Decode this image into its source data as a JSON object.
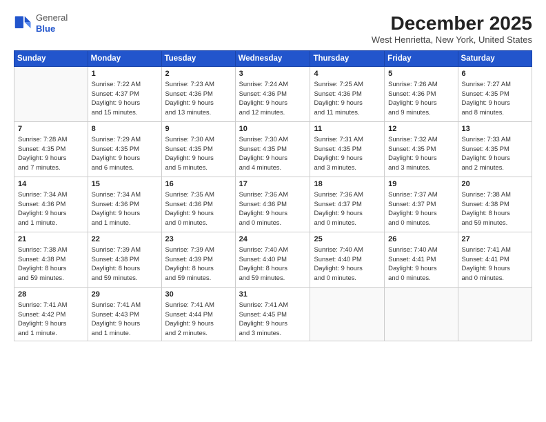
{
  "logo": {
    "general": "General",
    "blue": "Blue"
  },
  "title": "December 2025",
  "location": "West Henrietta, New York, United States",
  "days_header": [
    "Sunday",
    "Monday",
    "Tuesday",
    "Wednesday",
    "Thursday",
    "Friday",
    "Saturday"
  ],
  "weeks": [
    [
      {
        "day": "",
        "info": ""
      },
      {
        "day": "1",
        "info": "Sunrise: 7:22 AM\nSunset: 4:37 PM\nDaylight: 9 hours\nand 15 minutes."
      },
      {
        "day": "2",
        "info": "Sunrise: 7:23 AM\nSunset: 4:36 PM\nDaylight: 9 hours\nand 13 minutes."
      },
      {
        "day": "3",
        "info": "Sunrise: 7:24 AM\nSunset: 4:36 PM\nDaylight: 9 hours\nand 12 minutes."
      },
      {
        "day": "4",
        "info": "Sunrise: 7:25 AM\nSunset: 4:36 PM\nDaylight: 9 hours\nand 11 minutes."
      },
      {
        "day": "5",
        "info": "Sunrise: 7:26 AM\nSunset: 4:36 PM\nDaylight: 9 hours\nand 9 minutes."
      },
      {
        "day": "6",
        "info": "Sunrise: 7:27 AM\nSunset: 4:35 PM\nDaylight: 9 hours\nand 8 minutes."
      }
    ],
    [
      {
        "day": "7",
        "info": "Sunrise: 7:28 AM\nSunset: 4:35 PM\nDaylight: 9 hours\nand 7 minutes."
      },
      {
        "day": "8",
        "info": "Sunrise: 7:29 AM\nSunset: 4:35 PM\nDaylight: 9 hours\nand 6 minutes."
      },
      {
        "day": "9",
        "info": "Sunrise: 7:30 AM\nSunset: 4:35 PM\nDaylight: 9 hours\nand 5 minutes."
      },
      {
        "day": "10",
        "info": "Sunrise: 7:30 AM\nSunset: 4:35 PM\nDaylight: 9 hours\nand 4 minutes."
      },
      {
        "day": "11",
        "info": "Sunrise: 7:31 AM\nSunset: 4:35 PM\nDaylight: 9 hours\nand 3 minutes."
      },
      {
        "day": "12",
        "info": "Sunrise: 7:32 AM\nSunset: 4:35 PM\nDaylight: 9 hours\nand 3 minutes."
      },
      {
        "day": "13",
        "info": "Sunrise: 7:33 AM\nSunset: 4:35 PM\nDaylight: 9 hours\nand 2 minutes."
      }
    ],
    [
      {
        "day": "14",
        "info": "Sunrise: 7:34 AM\nSunset: 4:36 PM\nDaylight: 9 hours\nand 1 minute."
      },
      {
        "day": "15",
        "info": "Sunrise: 7:34 AM\nSunset: 4:36 PM\nDaylight: 9 hours\nand 1 minute."
      },
      {
        "day": "16",
        "info": "Sunrise: 7:35 AM\nSunset: 4:36 PM\nDaylight: 9 hours\nand 0 minutes."
      },
      {
        "day": "17",
        "info": "Sunrise: 7:36 AM\nSunset: 4:36 PM\nDaylight: 9 hours\nand 0 minutes."
      },
      {
        "day": "18",
        "info": "Sunrise: 7:36 AM\nSunset: 4:37 PM\nDaylight: 9 hours\nand 0 minutes."
      },
      {
        "day": "19",
        "info": "Sunrise: 7:37 AM\nSunset: 4:37 PM\nDaylight: 9 hours\nand 0 minutes."
      },
      {
        "day": "20",
        "info": "Sunrise: 7:38 AM\nSunset: 4:38 PM\nDaylight: 8 hours\nand 59 minutes."
      }
    ],
    [
      {
        "day": "21",
        "info": "Sunrise: 7:38 AM\nSunset: 4:38 PM\nDaylight: 8 hours\nand 59 minutes."
      },
      {
        "day": "22",
        "info": "Sunrise: 7:39 AM\nSunset: 4:38 PM\nDaylight: 8 hours\nand 59 minutes."
      },
      {
        "day": "23",
        "info": "Sunrise: 7:39 AM\nSunset: 4:39 PM\nDaylight: 8 hours\nand 59 minutes."
      },
      {
        "day": "24",
        "info": "Sunrise: 7:40 AM\nSunset: 4:40 PM\nDaylight: 8 hours\nand 59 minutes."
      },
      {
        "day": "25",
        "info": "Sunrise: 7:40 AM\nSunset: 4:40 PM\nDaylight: 9 hours\nand 0 minutes."
      },
      {
        "day": "26",
        "info": "Sunrise: 7:40 AM\nSunset: 4:41 PM\nDaylight: 9 hours\nand 0 minutes."
      },
      {
        "day": "27",
        "info": "Sunrise: 7:41 AM\nSunset: 4:41 PM\nDaylight: 9 hours\nand 0 minutes."
      }
    ],
    [
      {
        "day": "28",
        "info": "Sunrise: 7:41 AM\nSunset: 4:42 PM\nDaylight: 9 hours\nand 1 minute."
      },
      {
        "day": "29",
        "info": "Sunrise: 7:41 AM\nSunset: 4:43 PM\nDaylight: 9 hours\nand 1 minute."
      },
      {
        "day": "30",
        "info": "Sunrise: 7:41 AM\nSunset: 4:44 PM\nDaylight: 9 hours\nand 2 minutes."
      },
      {
        "day": "31",
        "info": "Sunrise: 7:41 AM\nSunset: 4:45 PM\nDaylight: 9 hours\nand 3 minutes."
      },
      {
        "day": "",
        "info": ""
      },
      {
        "day": "",
        "info": ""
      },
      {
        "day": "",
        "info": ""
      }
    ]
  ]
}
